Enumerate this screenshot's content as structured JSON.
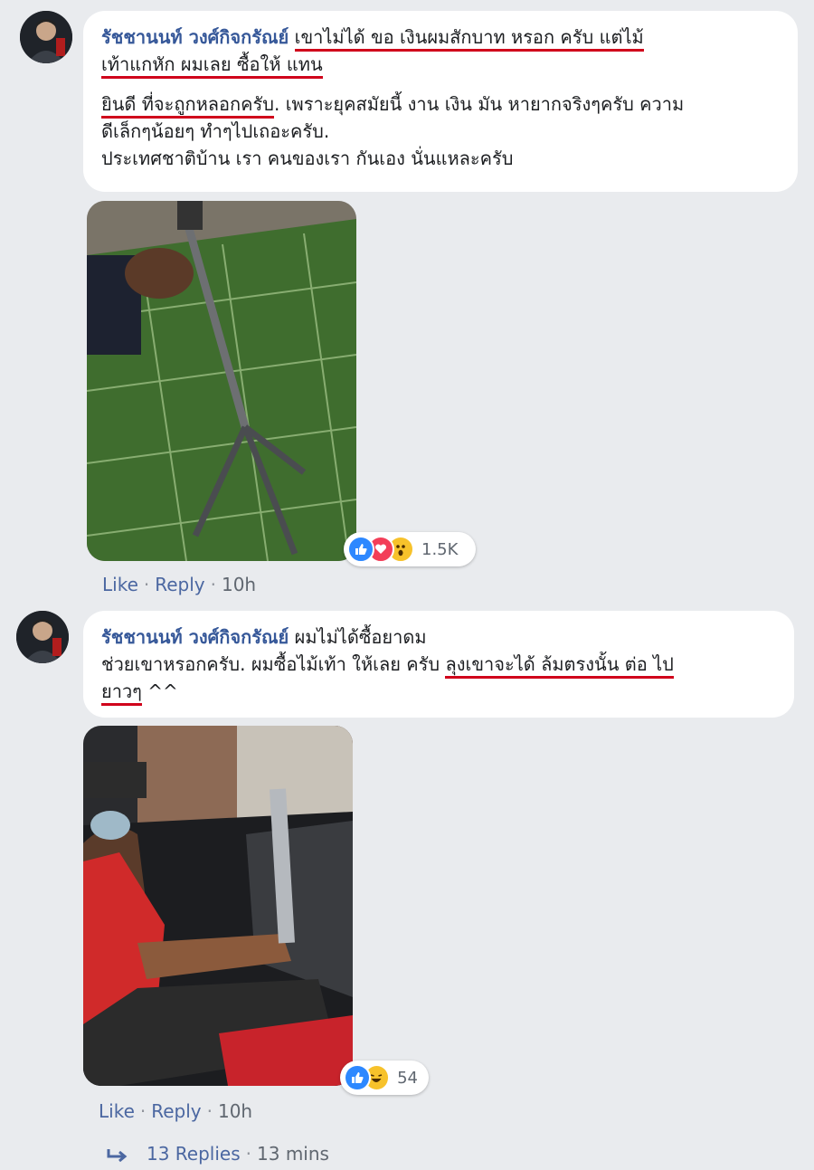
{
  "comments": [
    {
      "author": "รัชชานนท์ วงศ์กิจกรัณย์",
      "line1_text": "เขาไม่ได้ ขอ เงินผมสักบาท หรอก ครับ แต่ไม้",
      "line2_text": "เท้าแกหัก ผมเลย ซื้อให้ แทน",
      "para2_line1_underlined": "ยินดี ที่จะถูกหลอกครับ",
      "para2_line1_rest": ". เพราะยุคสมัยนี้ งาน เงิน มัน หายากจริงๆครับ ความ",
      "para2_line2": "ดีเล็กๆน้อยๆ ทำๆไปเถอะครับ.",
      "para2_line3": "ประเทศชาติบ้าน เรา คนของเรา กันเอง นั่นแหละครับ",
      "reaction_count": "1.5K",
      "reactions": [
        "like-icon",
        "love-icon",
        "wow-icon"
      ],
      "like_label": "Like",
      "reply_label": "Reply",
      "time": "10h"
    },
    {
      "author": "รัชชานนท์ วงศ์กิจกรัณย์",
      "line1_rest": "ผมไม่ได้ซื้อยาดม",
      "line2_plain": "ช่วยเขาหรอกครับ. ผมซื้อไม้เท้า ให้เลย ครับ ",
      "line2_underlined": "ลุงเขาจะได้ ล้มตรงนั้น ต่อ ไป",
      "line3_underlined": "ยาวๆ",
      "line3_rest": " ^^",
      "reaction_count": "54",
      "reactions": [
        "like-icon",
        "haha-icon"
      ],
      "like_label": "Like",
      "reply_label": "Reply",
      "time": "10h"
    }
  ],
  "replies": {
    "label": "13 Replies",
    "time": "13 mins"
  },
  "colors": {
    "author": "#365899",
    "underline": "#d0021b",
    "link": "#4b67a1",
    "background": "#e9ebee"
  }
}
